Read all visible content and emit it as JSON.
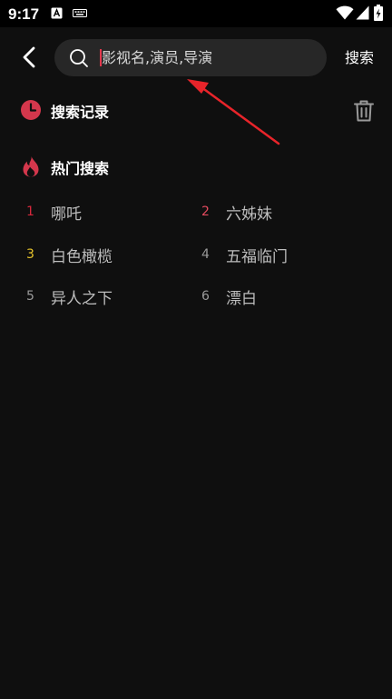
{
  "status_bar": {
    "time": "9:17"
  },
  "header": {
    "search_placeholder": "影视名,演员,导演",
    "search_button_label": "搜索"
  },
  "history_section": {
    "title": "搜索记录"
  },
  "hot_section": {
    "title": "热门搜索",
    "items": [
      {
        "rank": "1",
        "title": "哪吒",
        "rank_color": "#d6283c"
      },
      {
        "rank": "2",
        "title": "六姊妹",
        "rank_color": "#e34a5e"
      },
      {
        "rank": "3",
        "title": "白色橄榄",
        "rank_color": "#e6c32b"
      },
      {
        "rank": "4",
        "title": "五福临门",
        "rank_color": "#9a9a9a"
      },
      {
        "rank": "5",
        "title": "异人之下",
        "rank_color": "#9a9a9a"
      },
      {
        "rank": "6",
        "title": "漂白",
        "rank_color": "#9a9a9a"
      }
    ]
  },
  "colors": {
    "accent": "#e0344c",
    "background": "#0f0f0f",
    "search_box": "#272727",
    "annotation": "#e8242a"
  }
}
